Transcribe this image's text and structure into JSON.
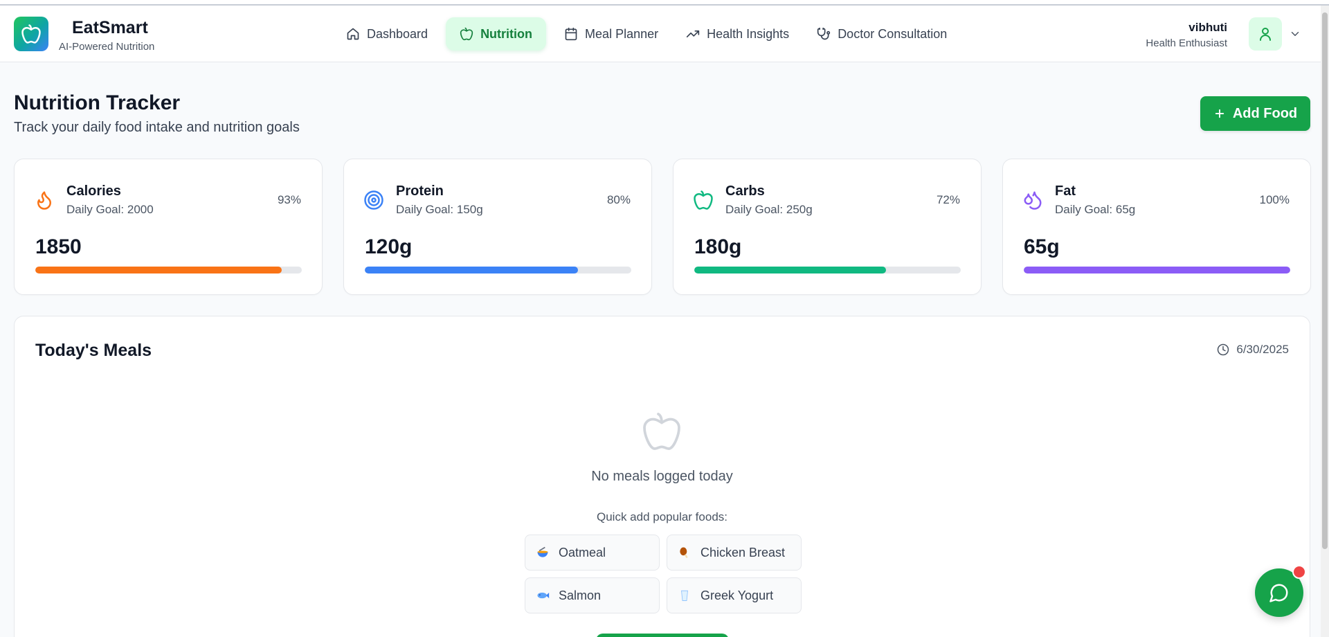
{
  "brand": {
    "name": "EatSmart",
    "tagline": "AI-Powered Nutrition"
  },
  "nav": {
    "items": [
      {
        "label": "Dashboard",
        "icon": "home-icon",
        "active": false
      },
      {
        "label": "Nutrition",
        "icon": "apple-icon",
        "active": true
      },
      {
        "label": "Meal Planner",
        "icon": "calendar-icon",
        "active": false
      },
      {
        "label": "Health Insights",
        "icon": "trending-up-icon",
        "active": false
      },
      {
        "label": "Doctor Consultation",
        "icon": "stethoscope-icon",
        "active": false
      }
    ]
  },
  "user": {
    "name": "vibhuti",
    "role": "Health Enthusiast",
    "icon": "user-icon"
  },
  "page": {
    "title": "Nutrition Tracker",
    "subtitle": "Track your daily food intake and nutrition goals",
    "add_button": "Add Food"
  },
  "stats": [
    {
      "name": "Calories",
      "goal": "Daily Goal: 2000",
      "value": "1850",
      "percent": "93%",
      "progress": 0.925,
      "color": "#f97316",
      "icon": "flame-icon"
    },
    {
      "name": "Protein",
      "goal": "Daily Goal: 150g",
      "value": "120g",
      "percent": "80%",
      "progress": 0.8,
      "color": "#3b82f6",
      "icon": "target-icon"
    },
    {
      "name": "Carbs",
      "goal": "Daily Goal: 250g",
      "value": "180g",
      "percent": "72%",
      "progress": 0.72,
      "color": "#10b981",
      "icon": "apple-icon"
    },
    {
      "name": "Fat",
      "goal": "Daily Goal: 65g",
      "value": "65g",
      "percent": "100%",
      "progress": 1.0,
      "color": "#8b5cf6",
      "icon": "droplets-icon"
    }
  ],
  "meals": {
    "title": "Today's Meals",
    "date": "6/30/2025",
    "empty_text": "No meals logged today",
    "quick_label": "Quick add popular foods:",
    "quick_foods": [
      {
        "label": "Oatmeal",
        "emoji": "🥣"
      },
      {
        "label": "Chicken Breast",
        "emoji": "🍗"
      },
      {
        "label": "Salmon",
        "emoji": "🐟"
      },
      {
        "label": "Greek Yogurt",
        "emoji": "🥛"
      }
    ]
  },
  "colors": {
    "primary": "#16a34a",
    "active_bg": "#dcfce7",
    "notification": "#ef4444"
  }
}
